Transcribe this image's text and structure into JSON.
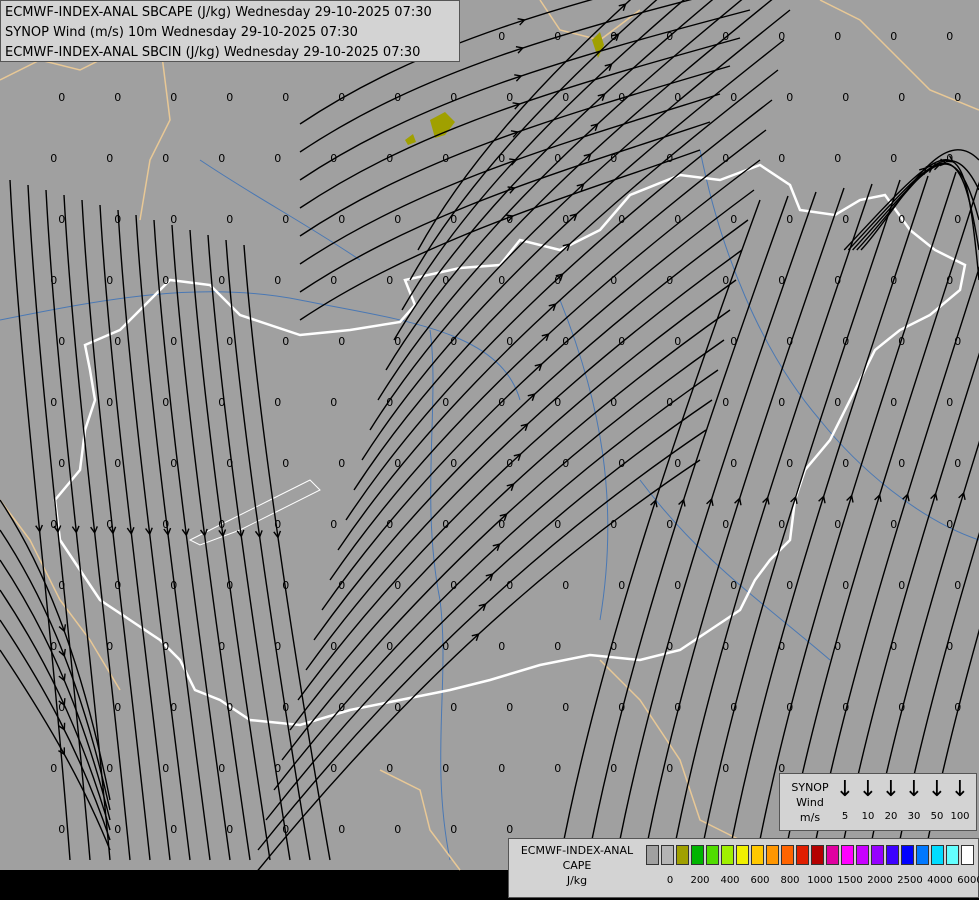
{
  "title_lines": [
    "ECMWF-INDEX-ANAL SBCAPE (J/kg) Wednesday 29-10-2025 07:30",
    "SYNOP Wind (m/s) 10m Wednesday 29-10-2025 07:30",
    "ECMWF-INDEX-ANAL SBCIN (J/kg) Wednesday 29-10-2025 07:30"
  ],
  "map": {
    "background": "#a0a0a0",
    "border_color": "#ffffff",
    "country_border_color": "#e8c896",
    "river_color": "#4a78b4",
    "streamline_color": "#000000",
    "cape_patch_color": "#a0a000",
    "zero_label": "0"
  },
  "synop_legend": {
    "title": "SYNOP",
    "subtitle": "Wind",
    "unit": "m/s",
    "arrow_icon": "↓",
    "values": [
      "5",
      "10",
      "20",
      "30",
      "50",
      "100"
    ]
  },
  "cape_legend": {
    "title": "ECMWF-INDEX-ANAL",
    "subtitle": "CAPE",
    "unit": "J/kg",
    "colors": [
      "#a0a0a0",
      "#b4b4b4",
      "#a0a000",
      "#00b400",
      "#50dc00",
      "#a0f000",
      "#f0f000",
      "#ffc800",
      "#ff9600",
      "#ff6400",
      "#e01e00",
      "#b40000",
      "#e000a0",
      "#ff00ff",
      "#c800ff",
      "#9600ff",
      "#3c00ff",
      "#0000ff",
      "#0078ff",
      "#00dcff",
      "#64ffff",
      "#ffffff"
    ],
    "ticks": [
      "0",
      "200",
      "400",
      "600",
      "800",
      "1000",
      "1500",
      "2000",
      "2500",
      "4000",
      "6000"
    ]
  }
}
